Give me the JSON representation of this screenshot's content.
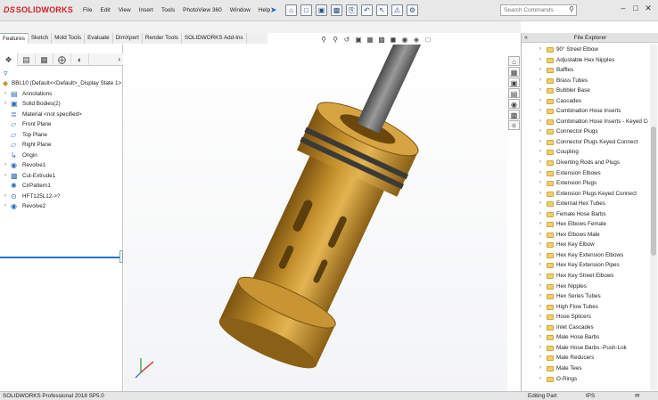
{
  "app": {
    "logo_ds": "DS",
    "logo_name": "SOLIDWORKS"
  },
  "menu": [
    "File",
    "Edit",
    "View",
    "Insert",
    "Tools",
    "PhotoView 360",
    "Window",
    "Help"
  ],
  "search": {
    "placeholder": "Search Commands"
  },
  "command_tabs": [
    "Features",
    "Sketch",
    "Mold Tools",
    "Evaluate",
    "DimXpert",
    "Render Tools",
    "SOLIDWORKS Add-Ins"
  ],
  "feature_tree": {
    "root": "BBL10  (Default<<Default>_Display State 1>",
    "items": [
      {
        "label": "Annotations",
        "icon": "annotations-icon",
        "expand": true
      },
      {
        "label": "Solid Bodies(2)",
        "icon": "solid-bodies-icon",
        "expand": true
      },
      {
        "label": "Material <not specified>",
        "icon": "material-icon",
        "expand": false
      },
      {
        "label": "Front Plane",
        "icon": "plane-icon",
        "expand": false
      },
      {
        "label": "Top Plane",
        "icon": "plane-icon",
        "expand": false
      },
      {
        "label": "Right Plane",
        "icon": "plane-icon",
        "expand": false
      },
      {
        "label": "Origin",
        "icon": "origin-icon",
        "expand": false
      },
      {
        "label": "Revolve1",
        "icon": "revolve-icon",
        "expand": true
      },
      {
        "label": "Cut-Extrude1",
        "icon": "cut-extrude-icon",
        "expand": true
      },
      {
        "label": "CirPattern1",
        "icon": "circular-pattern-icon",
        "expand": false
      },
      {
        "label": "HFT125L12->?",
        "icon": "hole-feature-icon",
        "expand": true
      },
      {
        "label": "Revolve2",
        "icon": "revolve-icon",
        "expand": true
      }
    ]
  },
  "file_explorer": {
    "title": "File Explorer",
    "items": [
      "90° Street Elbow",
      "Adjustable Hex Nipples",
      "Baffles",
      "Brass Tubes",
      "Bubbler Base",
      "Cascades",
      "Combination Hose Inserts",
      "Combination Hose Inserts - Keyed Cor",
      "Connector Plugs",
      "Connector Plugs Keyed Connect",
      "Coupling",
      "Diverting Rods and Plugs",
      "Extension Elbows",
      "Extension Plugs",
      "Extension Plugs Keyed Connect",
      "External Hex Tubes",
      "Female Hose Barbs",
      "Hex Elbows Female",
      "Hex Elbows Male",
      "Hex Key Elbow",
      "Hex Key Extension Elbows",
      "Hex Key Extension Pipes",
      "Hex Key Street Elbows",
      "Hex Nipples",
      "Hex Series Tubes",
      "High Flow Tubes",
      "Hose Splicers",
      "Inlet Cascades",
      "Male Hose Barbs",
      "Male Hose Barbs -Push-Lok",
      "Male Reducers",
      "Male Tees",
      "O-Rings"
    ]
  },
  "status_bar": {
    "version": "SOLIDWORKS Professional 2018 SP5.0",
    "mode": "Editing Part",
    "units": "IPS"
  },
  "colors": {
    "brass": "#c4902c",
    "brass_dark": "#7d5512",
    "accent_blue": "#1e74d1",
    "logo_red": "#d0202a"
  }
}
